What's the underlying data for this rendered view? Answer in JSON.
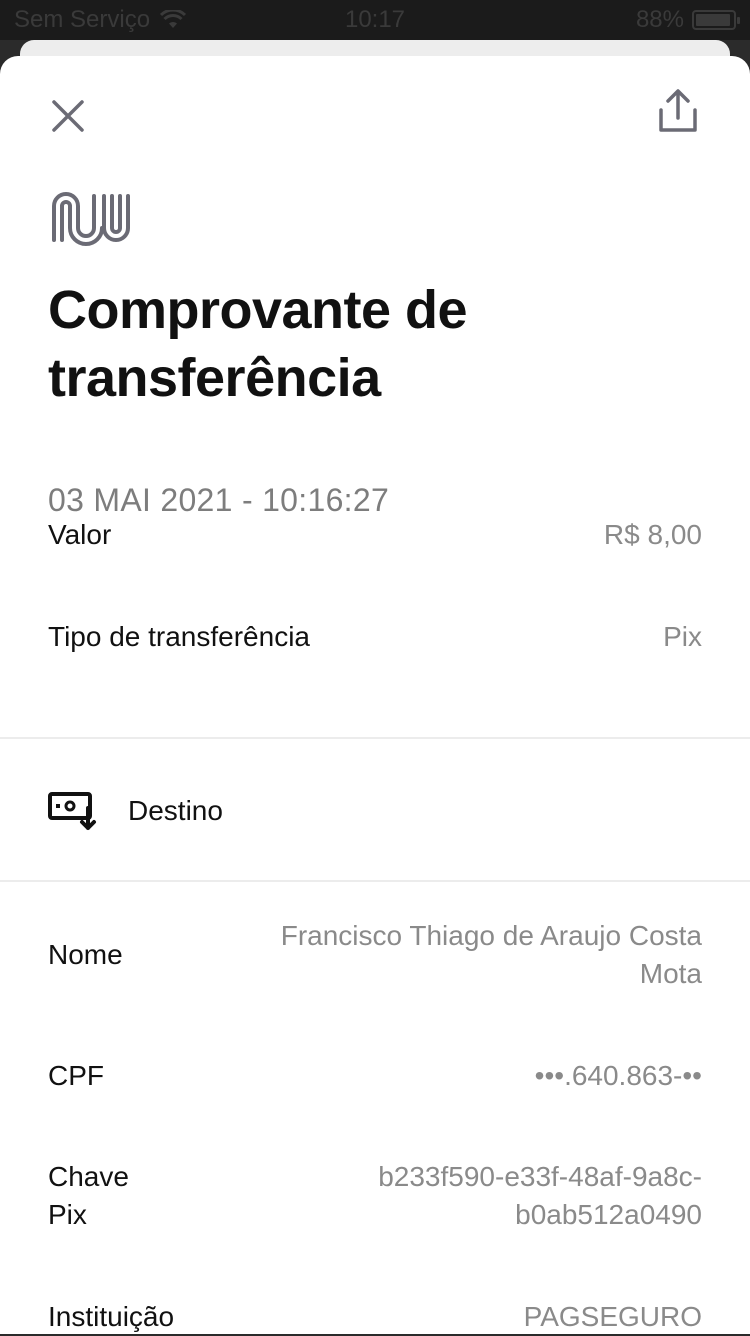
{
  "status_bar": {
    "carrier": "Sem Serviço",
    "time": "10:17",
    "battery": "88%"
  },
  "header": {
    "title": "Comprovante de transferência",
    "date": "03 MAI 2021 - 10:16:27"
  },
  "summary": {
    "valor_label": "Valor",
    "valor_value": "R$ 8,00",
    "tipo_label": "Tipo de transferência",
    "tipo_value": "Pix"
  },
  "destino": {
    "section_label": "Destino",
    "nome_label": "Nome",
    "nome_value_line1": "Francisco Thiago de Araujo Costa",
    "nome_value_line2": "Mota",
    "cpf_label": "CPF",
    "cpf_value": "•••.640.863-••",
    "chave_label_line1": "Chave",
    "chave_label_line2": "Pix",
    "chave_value_line1": "b233f590-e33f-48af-9a8c-",
    "chave_value_line2": "b0ab512a0490",
    "instituicao_label": "Instituição",
    "instituicao_value": "PAGSEGURO"
  },
  "icons": {
    "close": "close-icon",
    "share": "share-icon",
    "logo": "nubank-logo",
    "destino": "destination-account-icon"
  },
  "colors": {
    "text_primary": "#111111",
    "text_secondary": "#8a8a8a",
    "icon": "#6b6b75"
  }
}
